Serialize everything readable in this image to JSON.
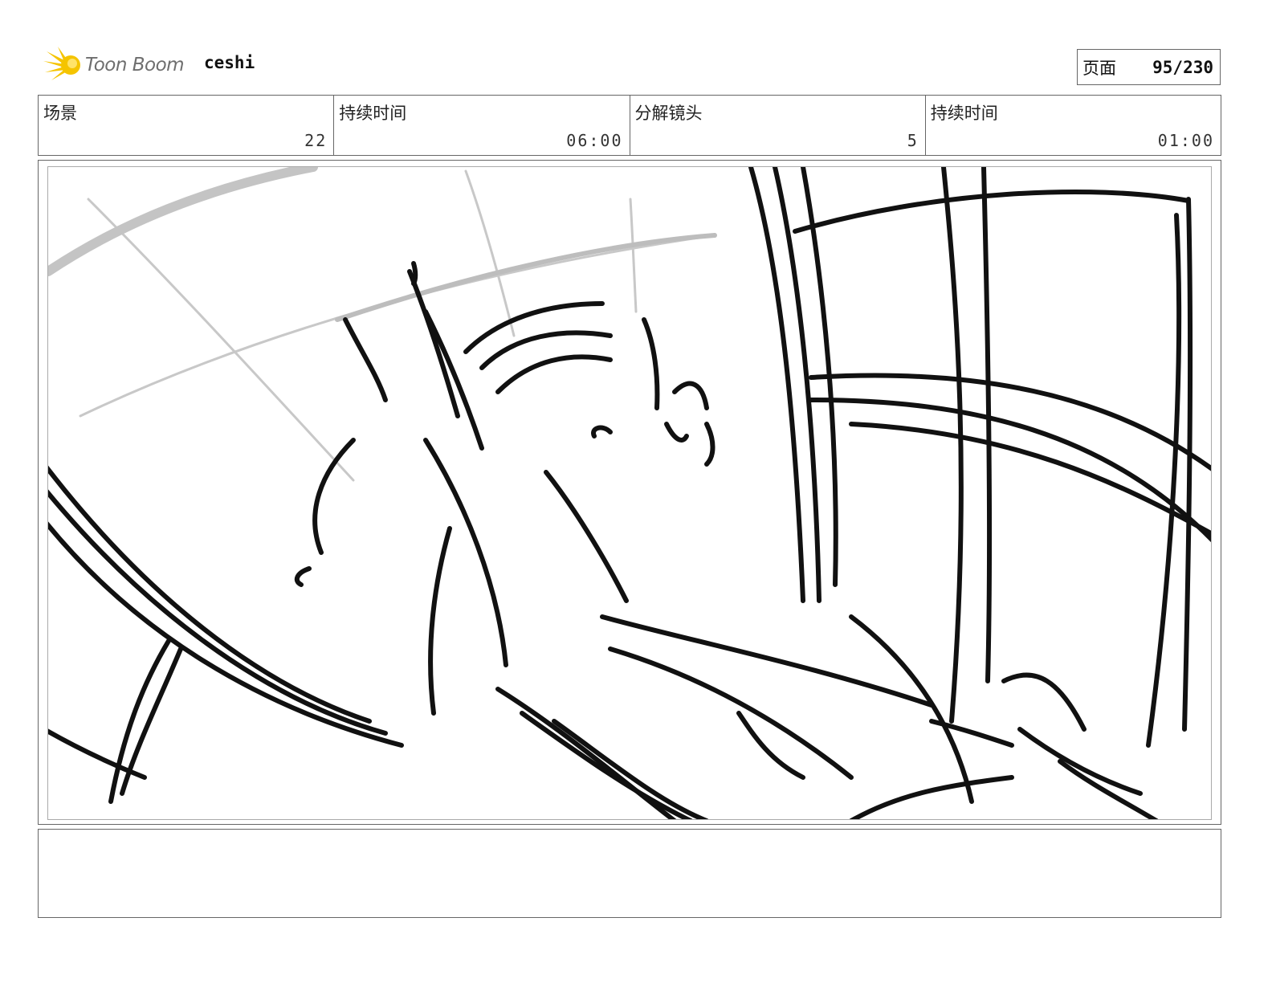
{
  "header": {
    "logo_text": "Toon Boom",
    "logo_icon": "toon-boom-burst-icon",
    "logo_color": "#f5c400",
    "project_name": "ceshi",
    "page_label": "页面",
    "page_value": "95/230"
  },
  "info": {
    "scene_label": "场景",
    "scene_value": "22",
    "scene_duration_label": "持续时间",
    "scene_duration_value": "06:00",
    "panel_label": "分解镜头",
    "panel_value": "5",
    "panel_duration_label": "持续时间",
    "panel_duration_value": "01:00"
  },
  "notes": {
    "text": ""
  }
}
